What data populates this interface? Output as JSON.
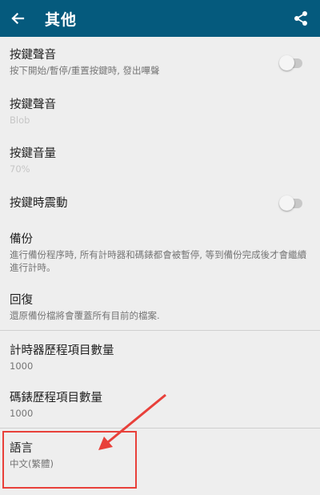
{
  "appbar": {
    "title": "其他",
    "back_icon": "arrow-left-icon",
    "share_icon": "share-icon",
    "color": "#055a7d"
  },
  "settings": [
    {
      "title": "按鍵聲音",
      "subtitle": "按下開始/暫停/重置按鍵時, 發出嗶聲",
      "toggle": false
    },
    {
      "title": "按鍵聲音",
      "subtitle": "Blob"
    },
    {
      "title": "按鍵音量",
      "subtitle": "70%"
    },
    {
      "title": "按鍵時震動",
      "toggle": false
    },
    {
      "title": "備份",
      "subtitle": "進行備份程序時, 所有計時器和碼錶都會被暫停, 等到備份完成後才會繼續進行計時。"
    },
    {
      "title": "回復",
      "subtitle": "還原備份檔將會覆蓋所有目前的檔案."
    },
    {
      "title": "計時器歷程項目數量",
      "subtitle": "1000"
    },
    {
      "title": "碼錶歷程項目數量",
      "subtitle": "1000"
    },
    {
      "title": "語言",
      "subtitle": "中文(繁體)"
    }
  ],
  "annotation": {
    "color": "#e8403a"
  }
}
